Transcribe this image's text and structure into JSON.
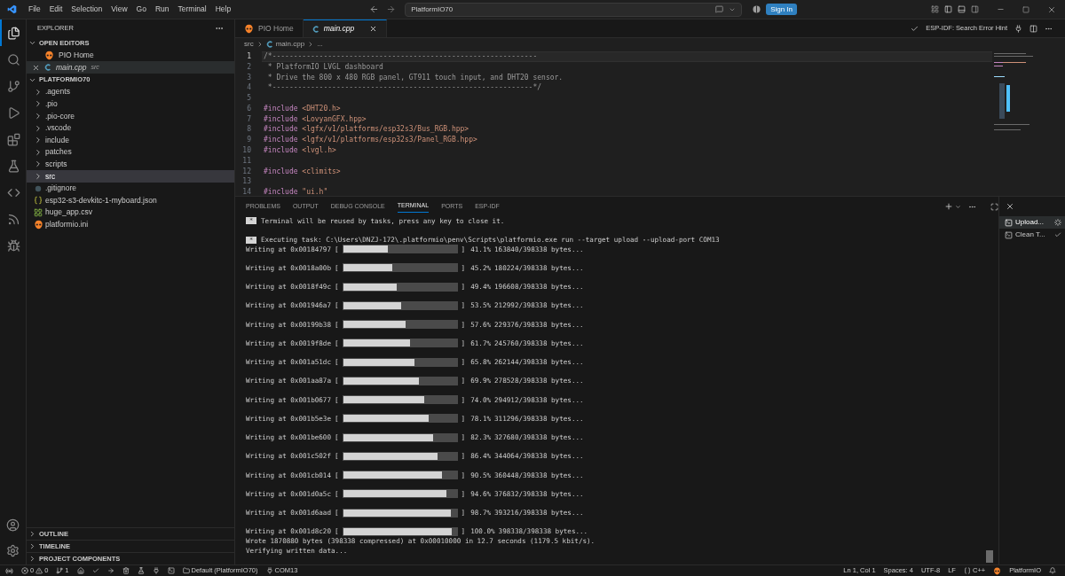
{
  "menu": [
    "File",
    "Edit",
    "Selection",
    "View",
    "Go",
    "Run",
    "Terminal",
    "Help"
  ],
  "command_center": {
    "value": "PlatformIO70"
  },
  "sign_in": "Sign In",
  "activity_bar": [
    {
      "selected": true
    },
    {
      "selected": false
    },
    {
      "selected": false
    },
    {
      "selected": false
    },
    {
      "selected": false
    },
    {
      "selected": false
    },
    {
      "selected": false
    },
    {
      "selected": false
    },
    {
      "selected": false
    }
  ],
  "sidebar": {
    "title": "EXPLORER",
    "open_editors": {
      "label": "OPEN EDITORS",
      "items": [
        {
          "name": "PIO Home",
          "kind": "pio",
          "selected": false
        },
        {
          "name": "main.cpp",
          "detail": "src",
          "kind": "cpp",
          "selected": true
        }
      ]
    },
    "project": {
      "label": "PLATFORMIO70",
      "items": [
        {
          "name": ".agents",
          "kind": "folder",
          "selected": false
        },
        {
          "name": ".pio",
          "kind": "folder",
          "selected": false
        },
        {
          "name": ".pio-core",
          "kind": "folder",
          "selected": false
        },
        {
          "name": ".vscode",
          "kind": "folder",
          "selected": false
        },
        {
          "name": "include",
          "kind": "folder",
          "selected": false
        },
        {
          "name": "patches",
          "kind": "folder",
          "selected": false
        },
        {
          "name": "scripts",
          "kind": "folder",
          "selected": false
        },
        {
          "name": "src",
          "kind": "folder",
          "selected": true
        },
        {
          "name": ".gitignore",
          "kind": "ignore",
          "selected": false
        },
        {
          "name": "esp32-s3-devkitc-1-myboard.json",
          "kind": "json",
          "selected": false
        },
        {
          "name": "huge_app.csv",
          "kind": "table",
          "selected": false
        },
        {
          "name": "platformio.ini",
          "kind": "config",
          "selected": false
        }
      ]
    },
    "bottom_sections": [
      "OUTLINE",
      "TIMELINE",
      "PROJECT COMPONENTS"
    ]
  },
  "editor_tabs": [
    {
      "label": "PIO Home",
      "kind": "pio",
      "selected": false
    },
    {
      "label": "main.cpp",
      "kind": "cpp",
      "selected": true
    }
  ],
  "editor_actions": {
    "label": "ESP-IDF: Search Error Hint"
  },
  "breadcrumb": [
    "src",
    "main.cpp",
    "..."
  ],
  "code": [
    {
      "number": "1",
      "selected": true,
      "parts": [
        {
          "kind": "comment",
          "text": "/*--------------------------------------------------------------"
        }
      ]
    },
    {
      "number": "2",
      "selected": false,
      "parts": [
        {
          "kind": "comment",
          "text": " * PlatformIO LVGL dashboard"
        }
      ]
    },
    {
      "number": "3",
      "selected": false,
      "parts": [
        {
          "kind": "comment",
          "text": " * Drive the 800 x 480 RGB panel, GT911 touch input, and DHT20 sensor."
        }
      ]
    },
    {
      "number": "4",
      "selected": false,
      "parts": [
        {
          "kind": "comment",
          "text": " *-------------------------------------------------------------*/"
        }
      ]
    },
    {
      "number": "5",
      "selected": false
    },
    {
      "number": "6",
      "selected": false,
      "parts": [
        {
          "kind": "directive",
          "text": "#include"
        },
        {
          "kind": "header",
          "text": "<DHT20.h>"
        }
      ]
    },
    {
      "number": "7",
      "selected": false,
      "parts": [
        {
          "kind": "directive",
          "text": "#include"
        },
        {
          "kind": "header",
          "text": "<LovyanGFX.hpp>"
        }
      ]
    },
    {
      "number": "8",
      "selected": false,
      "parts": [
        {
          "kind": "directive",
          "text": "#include"
        },
        {
          "kind": "header",
          "text": "<lgfx/v1/platforms/esp32s3/Bus_RGB.hpp>"
        }
      ]
    },
    {
      "number": "9",
      "selected": false,
      "parts": [
        {
          "kind": "directive",
          "text": "#include"
        },
        {
          "kind": "header",
          "text": "<lgfx/v1/platforms/esp32s3/Panel_RGB.hpp>"
        }
      ]
    },
    {
      "number": "10",
      "selected": false,
      "parts": [
        {
          "kind": "directive",
          "text": "#include"
        },
        {
          "kind": "header",
          "text": "<lvgl.h>"
        }
      ]
    },
    {
      "number": "11",
      "selected": false
    },
    {
      "number": "12",
      "selected": false,
      "parts": [
        {
          "kind": "directive",
          "text": "#include"
        },
        {
          "kind": "header",
          "text": "<climits>"
        }
      ]
    },
    {
      "number": "13",
      "selected": false
    },
    {
      "number": "14",
      "selected": false,
      "parts": [
        {
          "kind": "directive",
          "text": "#include"
        },
        {
          "kind": "string",
          "text": "\"ui.h\""
        }
      ]
    }
  ],
  "panel_tabs": [
    {
      "label": "PROBLEMS",
      "selected": false
    },
    {
      "label": "OUTPUT",
      "selected": false
    },
    {
      "label": "DEBUG CONSOLE",
      "selected": false
    },
    {
      "label": "TERMINAL",
      "selected": true
    },
    {
      "label": "PORTS",
      "selected": false
    },
    {
      "label": "ESP-IDF",
      "selected": false
    }
  ],
  "terminal": [
    {
      "kind": "notice",
      "marker": "*",
      "text": "Terminal will be reused by tasks, press any key to close it."
    },
    {
      "kind": "notice",
      "marker": "*",
      "text": "Executing task: C:\\Users\\DNZJ-172\\.platformio\\penv\\Scripts\\platformio.exe run --target upload --upload-port COM13"
    },
    {
      "kind": "progress",
      "open": "[",
      "close": "]",
      "address": "Writing at 0x00184797",
      "level": 0.411,
      "percent": "41.1%",
      "bytes": "163840/398338 bytes..."
    },
    {
      "kind": "progress",
      "open": "[",
      "close": "]",
      "address": "Writing at 0x0018a00b",
      "level": 0.452,
      "percent": "45.2%",
      "bytes": "180224/398338 bytes..."
    },
    {
      "kind": "progress",
      "open": "[",
      "close": "]",
      "address": "Writing at 0x0018f49c",
      "level": 0.494,
      "percent": "49.4%",
      "bytes": "196608/398338 bytes..."
    },
    {
      "kind": "progress",
      "open": "[",
      "close": "]",
      "address": "Writing at 0x001946a7",
      "level": 0.535,
      "percent": "53.5%",
      "bytes": "212992/398338 bytes..."
    },
    {
      "kind": "progress",
      "open": "[",
      "close": "]",
      "address": "Writing at 0x00199b38",
      "level": 0.576,
      "percent": "57.6%",
      "bytes": "229376/398338 bytes..."
    },
    {
      "kind": "progress",
      "open": "[",
      "close": "]",
      "address": "Writing at 0x0019f8de",
      "level": 0.617,
      "percent": "61.7%",
      "bytes": "245760/398338 bytes..."
    },
    {
      "kind": "progress",
      "open": "[",
      "close": "]",
      "address": "Writing at 0x001a51dc",
      "level": 0.658,
      "percent": "65.8%",
      "bytes": "262144/398338 bytes..."
    },
    {
      "kind": "progress",
      "open": "[",
      "close": "]",
      "address": "Writing at 0x001aa87a",
      "level": 0.699,
      "percent": "69.9%",
      "bytes": "278528/398338 bytes..."
    },
    {
      "kind": "progress",
      "open": "[",
      "close": "]",
      "address": "Writing at 0x001b0677",
      "level": 0.74,
      "percent": "74.0%",
      "bytes": "294912/398338 bytes..."
    },
    {
      "kind": "progress",
      "open": "[",
      "close": "]",
      "address": "Writing at 0x001b5e3e",
      "level": 0.781,
      "percent": "78.1%",
      "bytes": "311296/398338 bytes..."
    },
    {
      "kind": "progress",
      "open": "[",
      "close": "]",
      "address": "Writing at 0x001be600",
      "level": 0.823,
      "percent": "82.3%",
      "bytes": "327680/398338 bytes..."
    },
    {
      "kind": "progress",
      "open": "[",
      "close": "]",
      "address": "Writing at 0x001c502f",
      "level": 0.864,
      "percent": "86.4%",
      "bytes": "344064/398338 bytes..."
    },
    {
      "kind": "progress",
      "open": "[",
      "close": "]",
      "address": "Writing at 0x001cb014",
      "level": 0.905,
      "percent": "90.5%",
      "bytes": "360448/398338 bytes..."
    },
    {
      "kind": "progress",
      "open": "[",
      "close": "]",
      "address": "Writing at 0x001d0a5c",
      "level": 0.946,
      "percent": "94.6%",
      "bytes": "376832/398338 bytes..."
    },
    {
      "kind": "progress",
      "open": "[",
      "close": "]",
      "address": "Writing at 0x001d6aad",
      "level": 0.987,
      "percent": "98.7%",
      "bytes": "393216/398338 bytes..."
    },
    {
      "kind": "progress",
      "open": "[",
      "close": "]",
      "address": "Writing at 0x001d8c20",
      "level": 1,
      "percent": "100.0%",
      "bytes": "398338/398338 bytes..."
    },
    {
      "kind": "text",
      "text": "Wrote 1870880 bytes (398338 compressed) at 0x00010000 in 12.7 seconds (1179.5 kbit/s)."
    },
    {
      "kind": "text",
      "text": "Verifying written data..."
    }
  ],
  "terminal_list": [
    {
      "label": "Upload...",
      "selected": true,
      "kind": "running"
    },
    {
      "label": "Clean T...",
      "selected": false,
      "kind": "done"
    }
  ],
  "status_bar": {
    "errors": "0",
    "warnings": "0",
    "ports": "1",
    "environment": "Default (PlatformIO70)",
    "port": "COM13",
    "position": "Ln 1, Col 1",
    "spaces": "Spaces: 4",
    "encoding": "UTF-8",
    "eol": "LF",
    "language": "C++",
    "platform": "PlatformIO"
  }
}
